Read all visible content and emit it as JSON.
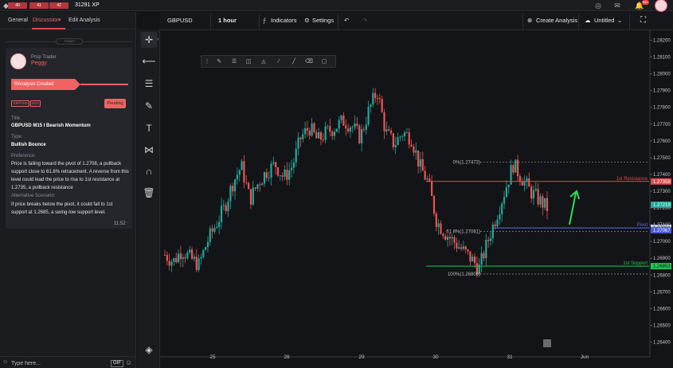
{
  "topbar": {
    "badges": [
      "40",
      "41",
      "42"
    ],
    "xp": "31291 XP",
    "notifications_count": "99+"
  },
  "left_panel": {
    "tabs": [
      {
        "label": "General"
      },
      {
        "label": "Discussion",
        "active": true
      },
      {
        "label": "Edit Analysis"
      }
    ],
    "close_glyph": "×",
    "today_label": "TODAY",
    "card": {
      "role": "Prop Trader",
      "user": "Peggy",
      "status_banner": "Analysis Created",
      "tags": [
        "GBPUSD",
        "M15"
      ],
      "status": "Pending",
      "fields": {
        "title_label": "Title",
        "title_value": "GBPUSD M15 I Bearish Momentum",
        "type_label": "Type",
        "type_value": "Bullish Bounce",
        "preference_label": "Preference:",
        "preference_text": "Price is failing toward the pivot of 1.2708, a pullback support close to 61.8% retracement. A reverse from this level could lead the price to rise to 1st resistance at 1.2735,  a pullback resistance",
        "alt_label": "Alternative Scenario:",
        "alt_text": "If price breaks below the pivot, it could fall to 1st support at 1.2685, a swing-low support level."
      },
      "time": "11:52"
    },
    "chat": {
      "placeholder": "Type here...",
      "gif_label": "GIF"
    }
  },
  "chart_header": {
    "symbol": "GBPUSD",
    "interval": "1 hour",
    "indicators_label": "Indicators",
    "settings_label": "Settings",
    "create_label": "Create Analysis",
    "layout_label": "Untitled"
  },
  "chart_data": {
    "type": "candlestick",
    "symbol": "GBPUSD",
    "interval": "1 hour",
    "y_axis": {
      "ticks": [
        "1.28200",
        "1.28100",
        "1.28000",
        "1.27900",
        "1.27800",
        "1.27700",
        "1.27600",
        "1.27500",
        "1.27400",
        "1.27300",
        "1.27200",
        "1.27100",
        "1.27000",
        "1.26900",
        "1.26800",
        "1.26700",
        "1.26600",
        "1.26500",
        "1.26400"
      ],
      "range": [
        1.2635,
        1.2825
      ]
    },
    "x_axis": {
      "ticks": [
        "25",
        "28",
        "29",
        "30",
        "31",
        "Jun"
      ]
    },
    "candles_count": 170,
    "price_path": [
      1.2692,
      1.2688,
      1.2695,
      1.269,
      1.2686,
      1.27,
      1.271,
      1.272,
      1.2735,
      1.2745,
      1.2725,
      1.2735,
      1.2742,
      1.2746,
      1.2738,
      1.2745,
      1.2762,
      1.2768,
      1.276,
      1.2765,
      1.2768,
      1.2772,
      1.2769,
      1.2762,
      1.2778,
      1.279,
      1.2765,
      1.2758,
      1.2765,
      1.2762,
      1.2745,
      1.2735,
      1.2712,
      1.2705,
      1.27,
      1.2695,
      1.269,
      1.2684,
      1.27,
      1.2715,
      1.273,
      1.2746,
      1.2738,
      1.273,
      1.2725,
      1.272
    ],
    "levels": [
      {
        "label": "1st Resistance",
        "price": "1.27358",
        "color": "#e5484d"
      },
      {
        "label": "Pivot",
        "price": "1.27081",
        "color": "#5b6cf0"
      },
      {
        "label": "1st Support",
        "price": "1.26853",
        "color": "#26c553"
      }
    ],
    "current_price": "1.27219",
    "fibonacci": [
      {
        "label": "0%(1.27473)",
        "price": 1.27473
      },
      {
        "label": "61.8%(1.27061)",
        "price": 1.27061
      },
      {
        "label": "100%(1.26806)",
        "price": 1.26806
      }
    ],
    "fib_extra_price": "1.27067",
    "colors": {
      "up": "#26a69a",
      "down": "#ef5350",
      "bg": "#131417"
    },
    "grid": false
  }
}
